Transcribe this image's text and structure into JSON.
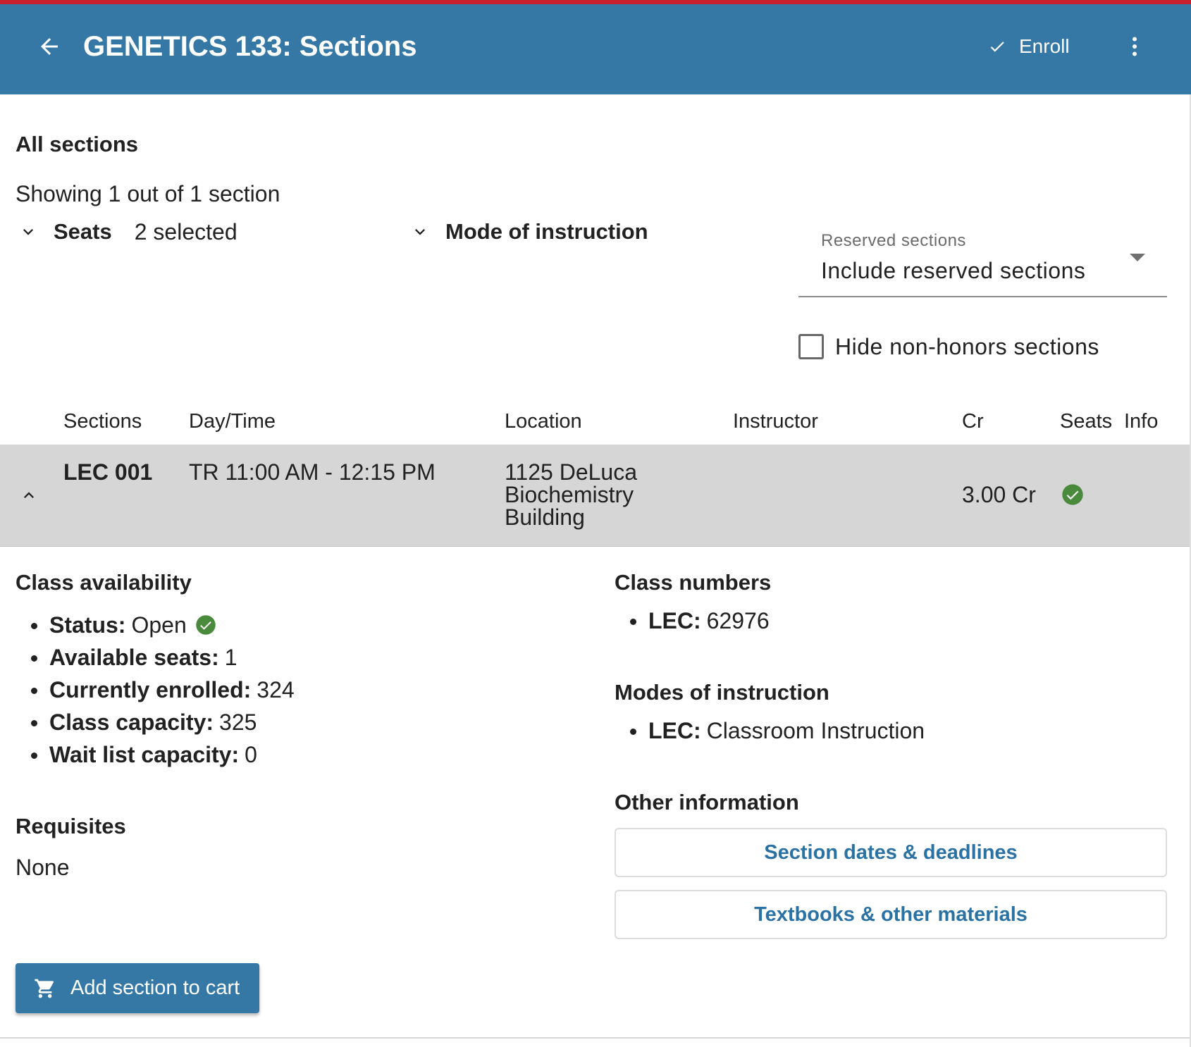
{
  "header": {
    "title": "GENETICS 133: Sections",
    "enroll_label": "Enroll",
    "accent_color": "#3578a5",
    "top_stripe_color": "#c5202e"
  },
  "filters": {
    "heading": "All sections",
    "showing_text": "Showing 1 out of 1 section",
    "seats_label": "Seats",
    "seats_selected": "2 selected",
    "mode_label": "Mode of instruction",
    "reserved_label": "Reserved sections",
    "reserved_value": "Include reserved sections",
    "hide_honors_label": "Hide non-honors sections",
    "hide_honors_checked": false
  },
  "table": {
    "columns": [
      "Sections",
      "Day/Time",
      "Location",
      "Instructor",
      "Cr",
      "Seats",
      "Info"
    ],
    "rows": [
      {
        "section": "LEC 001",
        "day_time": "TR 11:00 AM - 12:15 PM",
        "location_lines": [
          "1125 DeLuca",
          "Biochemistry",
          "Building"
        ],
        "instructor": "",
        "credits": "3.00 Cr",
        "seats_status": "open",
        "info": ""
      }
    ]
  },
  "details": {
    "availability_heading": "Class availability",
    "availability": [
      {
        "label": "Status:",
        "value": "Open"
      },
      {
        "label": "Available seats:",
        "value": "1"
      },
      {
        "label": "Currently enrolled:",
        "value": "324"
      },
      {
        "label": "Class capacity:",
        "value": "325"
      },
      {
        "label": "Wait list capacity:",
        "value": "0"
      }
    ],
    "requisites_heading": "Requisites",
    "requisites_value": "None",
    "class_numbers_heading": "Class numbers",
    "class_numbers": [
      {
        "label": "LEC:",
        "value": "62976"
      }
    ],
    "modes_heading": "Modes of instruction",
    "modes": [
      {
        "label": "LEC:",
        "value": "Classroom Instruction"
      }
    ],
    "other_heading": "Other information",
    "dates_button": "Section dates & deadlines",
    "textbooks_button": "Textbooks & other materials",
    "status_icon_color": "#4a8a3c"
  },
  "actions": {
    "add_to_cart": "Add section to cart"
  }
}
